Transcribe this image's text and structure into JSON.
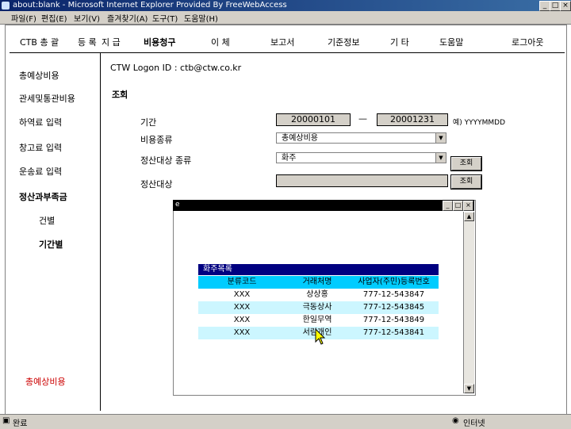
{
  "window": {
    "title": "about:blank - Microsoft Internet Explorer Provided By FreeWebAccess",
    "controls": [
      "_",
      "□",
      "×"
    ]
  },
  "menubar": [
    "파일(F)",
    "편집(E)",
    "보기(V)",
    "즐겨찾기(A)",
    "도구(T)",
    "도움말(H)"
  ],
  "nav": {
    "logo": "CTB 총 괄",
    "items": [
      "등 록",
      "지 급",
      "비용청구",
      "이 체",
      "보고서",
      "기준정보",
      "기 타",
      "도움말",
      "로그아웃"
    ]
  },
  "sidebar": {
    "items": [
      "총예상비용",
      "관세및통관비용",
      "하역료 입력",
      "창고료 입력",
      "운송료 입력",
      "정산과부족금",
      "건별",
      "기간별"
    ],
    "bottom": "총예상비용"
  },
  "main": {
    "logon": "CTW Logon ID : ctb@ctw.co.kr",
    "section": "조회",
    "period_label": "기간",
    "date_from": "20000101",
    "date_sep": "—",
    "date_to": "20001231",
    "date_hint": "예) YYYYMMDD",
    "cost_type_label": "비용종류",
    "cost_type_value": "총예상비용",
    "settle_type_label": "정산대상 종류",
    "settle_type_value": "화주",
    "settle_target_label": "정산대상",
    "settle_target_value": "",
    "query_button": "조회",
    "query_button2": "조회"
  },
  "popup": {
    "title": "",
    "table_title": "화주목록",
    "columns": [
      "분류코드",
      "거래처명",
      "사업자(주민)등록번호"
    ],
    "rows": [
      [
        "XXX",
        "상상홍",
        "777-12-543847"
      ],
      [
        "XXX",
        "극동상사",
        "777-12-543845"
      ],
      [
        "XXX",
        "한일무역",
        "777-12-543849"
      ],
      [
        "XXX",
        "서림개인",
        "777-12-543841"
      ]
    ]
  },
  "statusbar": {
    "left": "완료",
    "zone": "인터넷"
  },
  "colors": {
    "titlebar": "#0a246a",
    "table_header": "#000080",
    "column_header": "#00ccff",
    "row_tint": "#ccf6ff",
    "sidebar_accent": "#cc0000"
  }
}
